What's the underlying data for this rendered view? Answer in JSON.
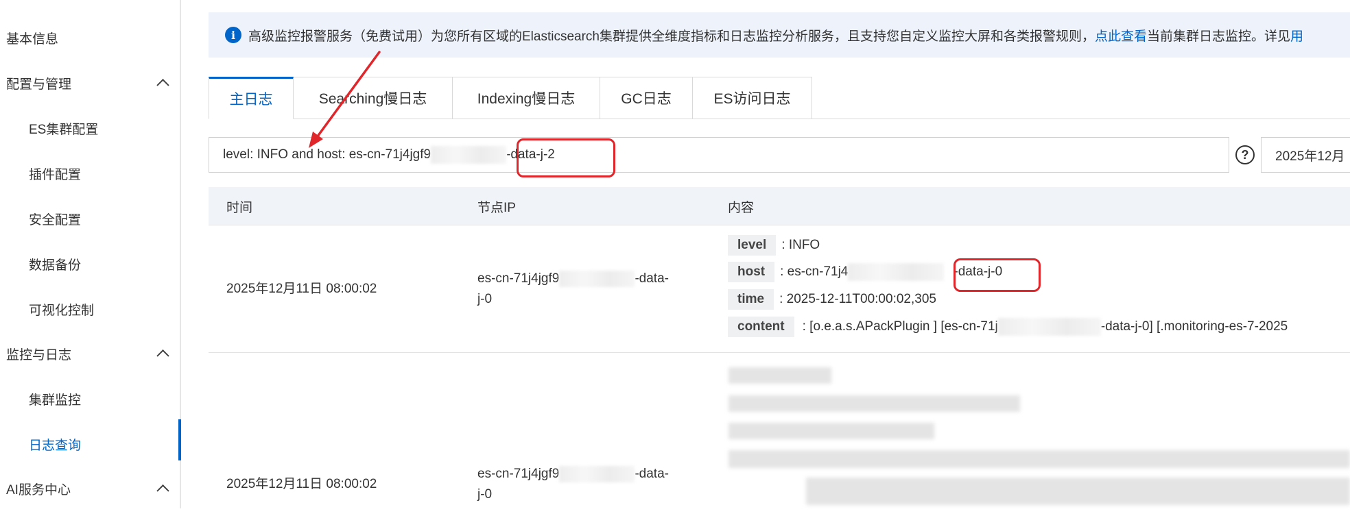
{
  "sidebar": {
    "items": [
      {
        "label": "基本信息"
      },
      {
        "label": "配置与管理"
      },
      {
        "label": "ES集群配置"
      },
      {
        "label": "插件配置"
      },
      {
        "label": "安全配置"
      },
      {
        "label": "数据备份"
      },
      {
        "label": "可视化控制"
      },
      {
        "label": "监控与日志"
      },
      {
        "label": "集群监控"
      },
      {
        "label": "日志查询"
      },
      {
        "label": "AI服务中心"
      }
    ]
  },
  "notice": {
    "text": "高级监控报警服务（免费试用）为您所有区域的Elasticsearch集群提供全维度指标和日志监控分析服务，且支持您自定义监控大屏和各类报警规则，",
    "link": "点此查看",
    "tail": "当前集群日志监控。详见",
    "tail_link": "用"
  },
  "tabs": [
    {
      "label": "主日志"
    },
    {
      "label": "Searching慢日志"
    },
    {
      "label": "Indexing慢日志"
    },
    {
      "label": "GC日志"
    },
    {
      "label": "ES访问日志"
    }
  ],
  "search": {
    "query_prefix": "level: INFO and host: es-cn-71j4jgf9",
    "query_suffix": "-data-j-2",
    "date": "2025年12月"
  },
  "table": {
    "headers": [
      "时间",
      "节点IP",
      "内容"
    ],
    "rows": [
      {
        "time": "2025年12月11日 08:00:02",
        "node_prefix": "es-cn-71j4jgf9",
        "node_suffix": "-data-",
        "node_line2": "j-0",
        "fields": {
          "level_key": "level",
          "level_val": ": INFO",
          "host_key": "host",
          "host_prefix": ": es-cn-71j4",
          "host_suffix": "-data-j-0",
          "time_key": "time",
          "time_val": ": 2025-12-11T00:00:02,305",
          "content_key": "content",
          "content_prefix": ": [o.e.a.s.APackPlugin ] [es-cn-71j",
          "content_suffix": "-data-j-0] [.monitoring-es-7-2025"
        }
      },
      {
        "time": "2025年12月11日 08:00:02",
        "node_prefix": "es-cn-71j4jgf9",
        "node_suffix": "-data-",
        "node_line2": "j-0"
      }
    ]
  },
  "colors": {
    "accent": "#0064c8",
    "annotation": "#e0262b"
  }
}
